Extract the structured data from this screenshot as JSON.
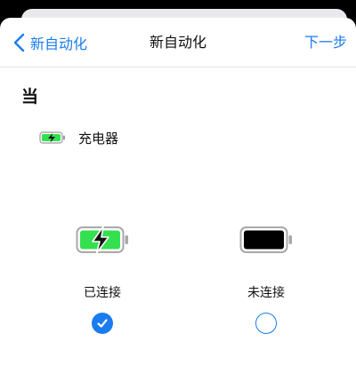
{
  "nav": {
    "back_label": "新自动化",
    "title": "新自动化",
    "next_label": "下一步"
  },
  "when": {
    "label": "当",
    "trigger": "充电器"
  },
  "options": [
    {
      "label": "已连接",
      "selected": true,
      "icon": "battery-charging-icon"
    },
    {
      "label": "未连接",
      "selected": false,
      "icon": "battery-icon"
    }
  ],
  "colors": {
    "accent": "#1a7cf0",
    "charging_fill": "#34e04f",
    "background": "#ffffff"
  }
}
